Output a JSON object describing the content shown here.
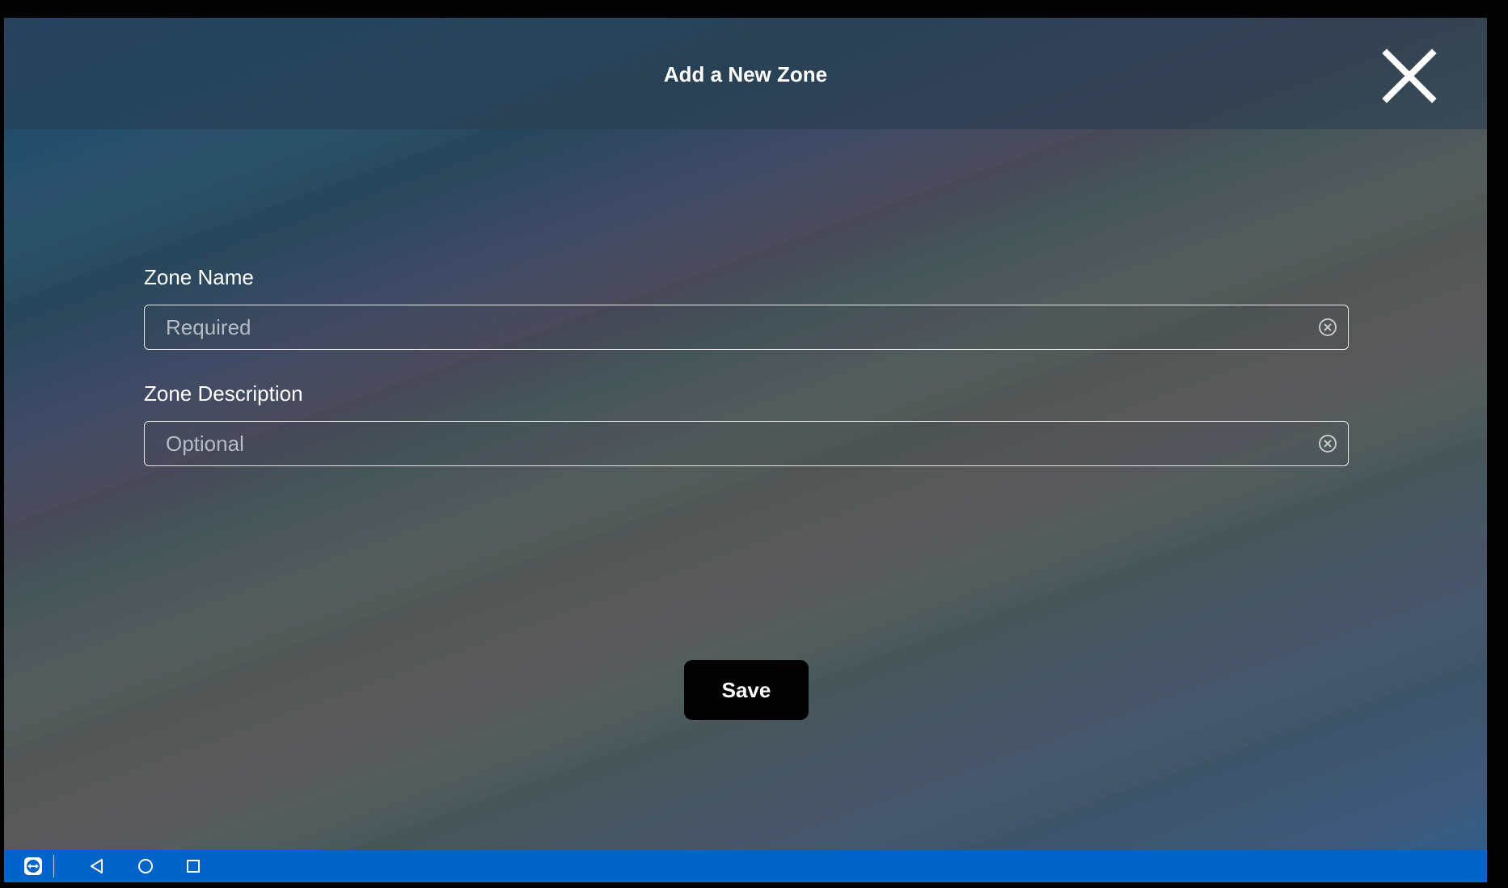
{
  "dialog": {
    "title": "Add a New Zone",
    "close_icon": "close-icon"
  },
  "form": {
    "zone_name": {
      "label": "Zone Name",
      "value": "",
      "placeholder": "Required",
      "clear_icon": "clear-circle-icon"
    },
    "zone_description": {
      "label": "Zone Description",
      "value": "",
      "placeholder": "Optional",
      "clear_icon": "clear-circle-icon"
    }
  },
  "actions": {
    "save_label": "Save"
  },
  "navbar": {
    "icons": [
      "teamviewer-icon",
      "back-icon",
      "home-icon",
      "recents-icon"
    ],
    "color": "#0064c8"
  },
  "colors": {
    "save_button": "#000000",
    "text": "#ffffff"
  }
}
